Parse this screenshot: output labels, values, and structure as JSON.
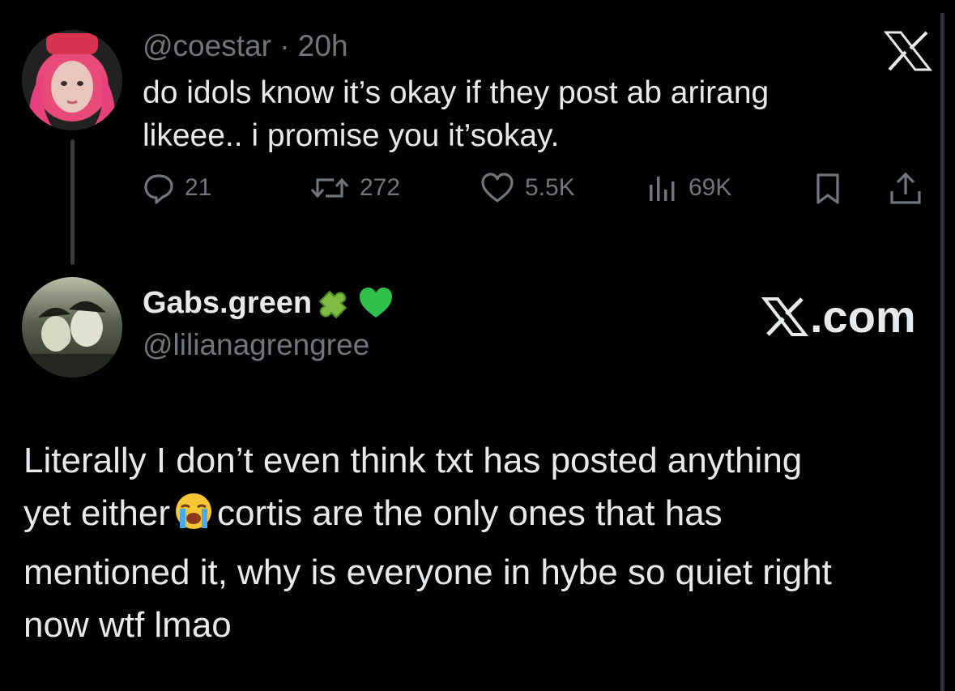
{
  "quoted": {
    "handle": "@coestar",
    "dot": "·",
    "time": "20h",
    "text_lines": [
      "do idols know it’s okay if they post ab arirang",
      "likeee.. i promise you it’sokay."
    ],
    "actions": {
      "replies": "21",
      "reposts": "272",
      "likes": "5.5K",
      "views": "69K"
    },
    "icons": [
      "reply-icon",
      "repost-icon",
      "like-icon",
      "views-icon",
      "bookmark-icon",
      "share-icon",
      "x-logo-icon"
    ]
  },
  "post": {
    "display_name": "Gabs.green",
    "name_emojis": [
      "puzzle-piece-emoji",
      "green-heart-emoji"
    ],
    "handle": "@lilianagrengree",
    "watermark": ".com",
    "body_lines": [
      "Literally I don’t even think txt has posted anything",
      "yet either",
      "cortis are the only ones that has",
      "mentioned it, why is everyone in hybe so quiet right",
      "now wtf lmao"
    ],
    "inline_emoji": "loudly-crying-face-emoji"
  },
  "colors": {
    "background": "#000000",
    "primary_text": "#e7e9ea",
    "secondary_text": "#71767b",
    "puzzle_green": "#7dbb42",
    "heart_green": "#2fc14b"
  }
}
